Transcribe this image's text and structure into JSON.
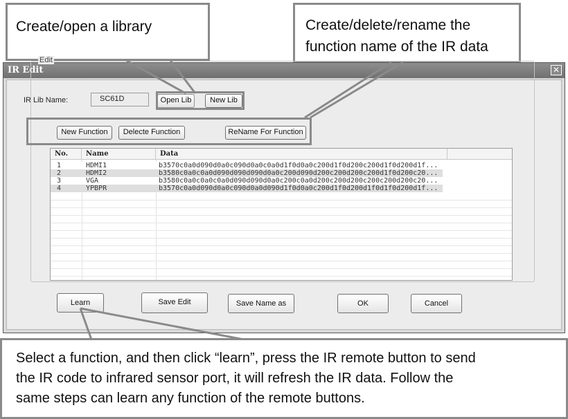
{
  "callouts": {
    "library": "Create/open a library",
    "function_line1": "Create/delete/rename the",
    "function_line2": "function name of the IR data",
    "learn_line1": "Select a function, and then click “learn”, press the IR remote button to send",
    "learn_line2": "the IR code to infrared sensor port, it will refresh the IR data. Follow the",
    "learn_line3": "same steps can learn any function of the remote buttons."
  },
  "dialog": {
    "title": "IR Edit",
    "close": "✕",
    "lib_label": "IR Lib Name:",
    "lib_value": "SC61D",
    "open_lib": "Open Lib",
    "new_lib": "New Lib",
    "edit_group": "Edit",
    "new_function": "New Function",
    "delete_function": "Delecte Function",
    "rename_function": "ReName For Function",
    "columns": [
      "No.",
      "Name",
      "Data"
    ],
    "rows": [
      {
        "no": "1",
        "name": "HDMI1",
        "data": "b3570c0a0d090d0a0c090d0a0c0a0d1f0d0a0c200d1f0d200c200d1f0d200d1f..."
      },
      {
        "no": "2",
        "name": "HDMI2",
        "data": "b3580c0a0c0a0d090d090d090d0a0c200d090d200c200d200c200d1f0d200c20..."
      },
      {
        "no": "3",
        "name": "VGA",
        "data": "b3580c0a0c0a0c0a0d090d090d0a0c200c0a0d200c200d200c200c200d200c20..."
      },
      {
        "no": "4",
        "name": "YPBPR",
        "data": "b3570c0a0d090d0a0c090d0a0d090d1f0d0a0c200d1f0d200d1f0d1f0d200d1f..."
      }
    ],
    "learn": "Learn",
    "save_edit": "Save Edit",
    "save_name_as": "Save Name as",
    "ok": "OK",
    "cancel": "Cancel"
  }
}
